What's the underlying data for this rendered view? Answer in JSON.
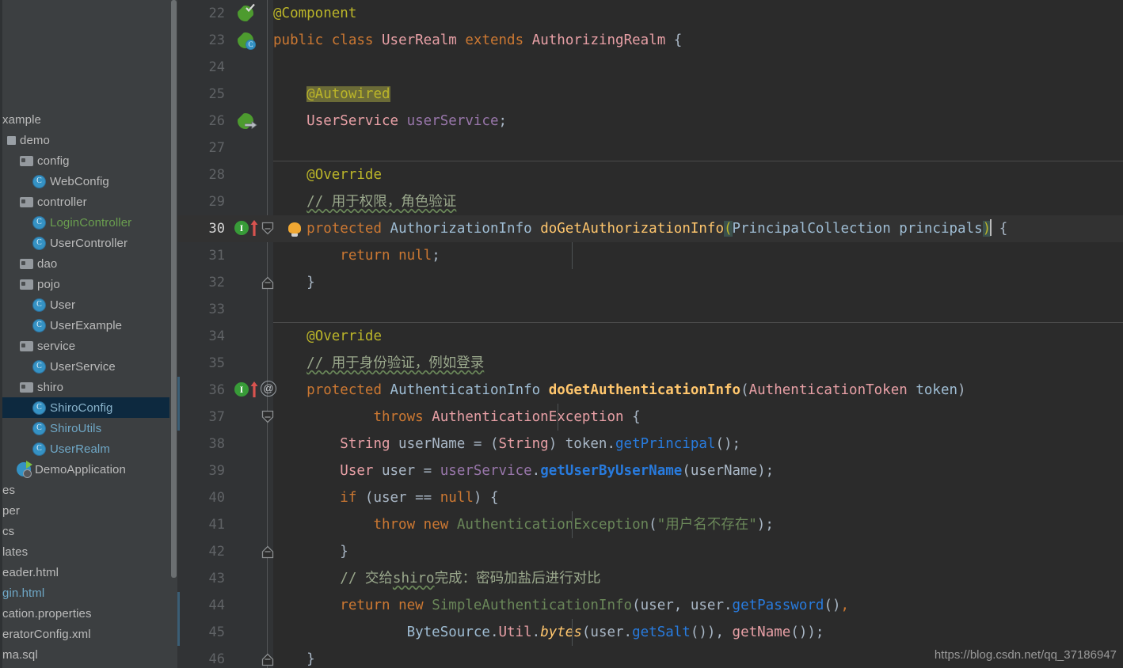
{
  "sidebar": {
    "scrollbar": {
      "name": "project-tree-scrollbar"
    },
    "items": [
      {
        "label": "xample",
        "indent": 0,
        "icon": "none",
        "style": "plain",
        "selected": false
      },
      {
        "label": "demo",
        "indent": 6,
        "icon": "module",
        "style": "plain",
        "selected": false
      },
      {
        "label": "config",
        "indent": 22,
        "icon": "folder",
        "style": "plain",
        "selected": false
      },
      {
        "label": "WebConfig",
        "indent": 38,
        "icon": "class",
        "style": "plain",
        "selected": false
      },
      {
        "label": "controller",
        "indent": 22,
        "icon": "folder",
        "style": "plain",
        "selected": false
      },
      {
        "label": "LoginController",
        "indent": 38,
        "icon": "class",
        "style": "green",
        "selected": false
      },
      {
        "label": "UserController",
        "indent": 38,
        "icon": "class",
        "style": "plain",
        "selected": false
      },
      {
        "label": "dao",
        "indent": 22,
        "icon": "folder",
        "style": "plain",
        "selected": false
      },
      {
        "label": "pojo",
        "indent": 22,
        "icon": "folder",
        "style": "plain",
        "selected": false
      },
      {
        "label": "User",
        "indent": 38,
        "icon": "class",
        "style": "plain",
        "selected": false
      },
      {
        "label": "UserExample",
        "indent": 38,
        "icon": "class",
        "style": "plain",
        "selected": false
      },
      {
        "label": "service",
        "indent": 22,
        "icon": "folder",
        "style": "plain",
        "selected": false
      },
      {
        "label": "UserService",
        "indent": 38,
        "icon": "class",
        "style": "plain",
        "selected": false
      },
      {
        "label": "shiro",
        "indent": 22,
        "icon": "folder",
        "style": "plain",
        "selected": false
      },
      {
        "label": "ShiroConfig",
        "indent": 38,
        "icon": "class",
        "style": "selected",
        "selected": true
      },
      {
        "label": "ShiroUtils",
        "indent": 38,
        "icon": "class",
        "style": "blue",
        "selected": false
      },
      {
        "label": "UserRealm",
        "indent": 38,
        "icon": "class",
        "style": "blue",
        "selected": false
      },
      {
        "label": "DemoApplication",
        "indent": 18,
        "icon": "spring-app",
        "style": "plain",
        "selected": false
      },
      {
        "label": "es",
        "indent": 0,
        "icon": "none",
        "style": "plain",
        "selected": false
      },
      {
        "label": "per",
        "indent": 0,
        "icon": "none",
        "style": "plain",
        "selected": false
      },
      {
        "label": "cs",
        "indent": 0,
        "icon": "none",
        "style": "plain",
        "selected": false
      },
      {
        "label": "lates",
        "indent": 0,
        "icon": "none",
        "style": "plain",
        "selected": false
      },
      {
        "label": "eader.html",
        "indent": 0,
        "icon": "none",
        "style": "plain",
        "selected": false
      },
      {
        "label": "gin.html",
        "indent": 0,
        "icon": "none",
        "style": "link",
        "selected": false
      },
      {
        "label": "cation.properties",
        "indent": 0,
        "icon": "none",
        "style": "plain",
        "selected": false
      },
      {
        "label": "eratorConfig.xml",
        "indent": 0,
        "icon": "none",
        "style": "plain",
        "selected": false
      },
      {
        "label": "ma.sql",
        "indent": 0,
        "icon": "none",
        "style": "plain",
        "selected": false
      }
    ]
  },
  "editor": {
    "file": "UserRealm",
    "current_line": 30,
    "first_visible_line": 22,
    "lines": [
      {
        "n": 22,
        "text": "@Component"
      },
      {
        "n": 23,
        "text": "public class UserRealm extends AuthorizingRealm {"
      },
      {
        "n": 24,
        "text": ""
      },
      {
        "n": 25,
        "text": "    @Autowired"
      },
      {
        "n": 26,
        "text": "    UserService userService;"
      },
      {
        "n": 27,
        "text": ""
      },
      {
        "n": 28,
        "text": "    @Override"
      },
      {
        "n": 29,
        "text": "    // 用于权限，角色验证"
      },
      {
        "n": 30,
        "text": "    protected AuthorizationInfo doGetAuthorizationInfo(PrincipalCollection principals) {"
      },
      {
        "n": 31,
        "text": "        return null;"
      },
      {
        "n": 32,
        "text": "    }"
      },
      {
        "n": 33,
        "text": ""
      },
      {
        "n": 34,
        "text": "    @Override"
      },
      {
        "n": 35,
        "text": "    // 用于身份验证，例如登录"
      },
      {
        "n": 36,
        "text": "    protected AuthenticationInfo doGetAuthenticationInfo(AuthenticationToken token)"
      },
      {
        "n": 37,
        "text": "            throws AuthenticationException {"
      },
      {
        "n": 38,
        "text": "        String userName = (String) token.getPrincipal();"
      },
      {
        "n": 39,
        "text": "        User user = userService.getUserByUserName(userName);"
      },
      {
        "n": 40,
        "text": "        if (user == null) {"
      },
      {
        "n": 41,
        "text": "            throw new AuthenticationException(\"用户名不存在\");"
      },
      {
        "n": 42,
        "text": "        }"
      },
      {
        "n": 43,
        "text": "        // 交给shiro完成：密码加盐后进行对比"
      },
      {
        "n": 44,
        "text": "        return new SimpleAuthenticationInfo(user, user.getPassword(),"
      },
      {
        "n": 45,
        "text": "                ByteSource.Util.bytes(user.getSalt()), getName());"
      },
      {
        "n": 46,
        "text": "    }"
      }
    ],
    "gutter_icons": [
      {
        "line": 22,
        "name": "spring-bean-icon"
      },
      {
        "line": 23,
        "name": "spring-bean-class-icon"
      },
      {
        "line": 26,
        "name": "spring-autowired-dependency-icon"
      },
      {
        "line": 30,
        "name": "implementing-method-icon"
      },
      {
        "line": 30,
        "name": "intention-bulb-icon"
      },
      {
        "line": 36,
        "name": "implementing-method-icon"
      },
      {
        "line": 36,
        "name": "annotation-icon"
      }
    ],
    "fold_markers": [
      30,
      32,
      37,
      42,
      46
    ],
    "vcs_changed_lines": [
      36,
      37,
      44,
      45
    ]
  },
  "watermark": {
    "text": "https://blog.csdn.net/qq_37186947"
  },
  "colors": {
    "editor_bg": "#2b2b2b",
    "gutter_bg": "#313335",
    "sidebar_bg": "#3c3f41",
    "selection_bg": "#0d293f",
    "keyword": "#cc7832",
    "annotation": "#bbb529",
    "method": "#ffc66d",
    "string": "#6a8759",
    "field": "#9876aa",
    "call": "#287bde",
    "comment_cn": "#9aa88c",
    "caret": "#bbbbbb"
  }
}
